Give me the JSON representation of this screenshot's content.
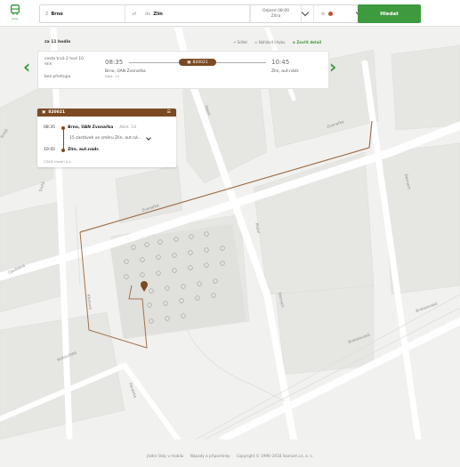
{
  "topbar": {
    "logo_label": "Jízdy",
    "from_prefix": "Z",
    "from_value": "Brno",
    "to_prefix": "do",
    "to_value": "Zlín",
    "depart_line1": "Odjezd 08:00",
    "depart_line2": "Zítra",
    "search_button": "Hledat"
  },
  "panel": {
    "heading": "za 11 hodin",
    "action_share": "Sdílet",
    "action_report": "Nahlásit chybu",
    "action_close": "Zavřít detail",
    "duration": "cesta trvá 2 hod 10 min",
    "transfers": "bez přestupu",
    "depart_time": "08:35",
    "arrive_time": "10:45",
    "line_no": "820021",
    "from_stop": "Brno, ÚAN Zvonařka",
    "from_platform": "Nást. 14",
    "to_stop": "Zlín, aut.nádr."
  },
  "route": {
    "line_no": "820021",
    "dep_time": "08:35",
    "dep_stop": "Brno, ÚAN Zvonařka",
    "dep_platform": "Nást. 14",
    "stops_info": "15 zastávek ve směru Zlín, aut.ná...",
    "arr_time": "10:45",
    "arr_stop": "Zlín, aut.nádr.",
    "carrier": "ČSAD Vsetín a.s."
  },
  "map_labels": {
    "street1": "Zvonařka",
    "street2": "Plotní",
    "street3": "Dornych",
    "street4": "Křenová",
    "street5": "Trnitá",
    "street6": "Opuštěná",
    "street7": "Koželužská",
    "street8": "Ponávka",
    "street9": "Bratislavská",
    "street10": "Zvonařka"
  },
  "footer": {
    "link1": "Jízdní řády v mobilu",
    "link2": "Nápady a připomínky",
    "copyright": "Copyright © 1996–2018 Seznam.cz, a. s."
  },
  "colors": {
    "accent": "#3e9a3e",
    "route": "#7b4a22"
  }
}
